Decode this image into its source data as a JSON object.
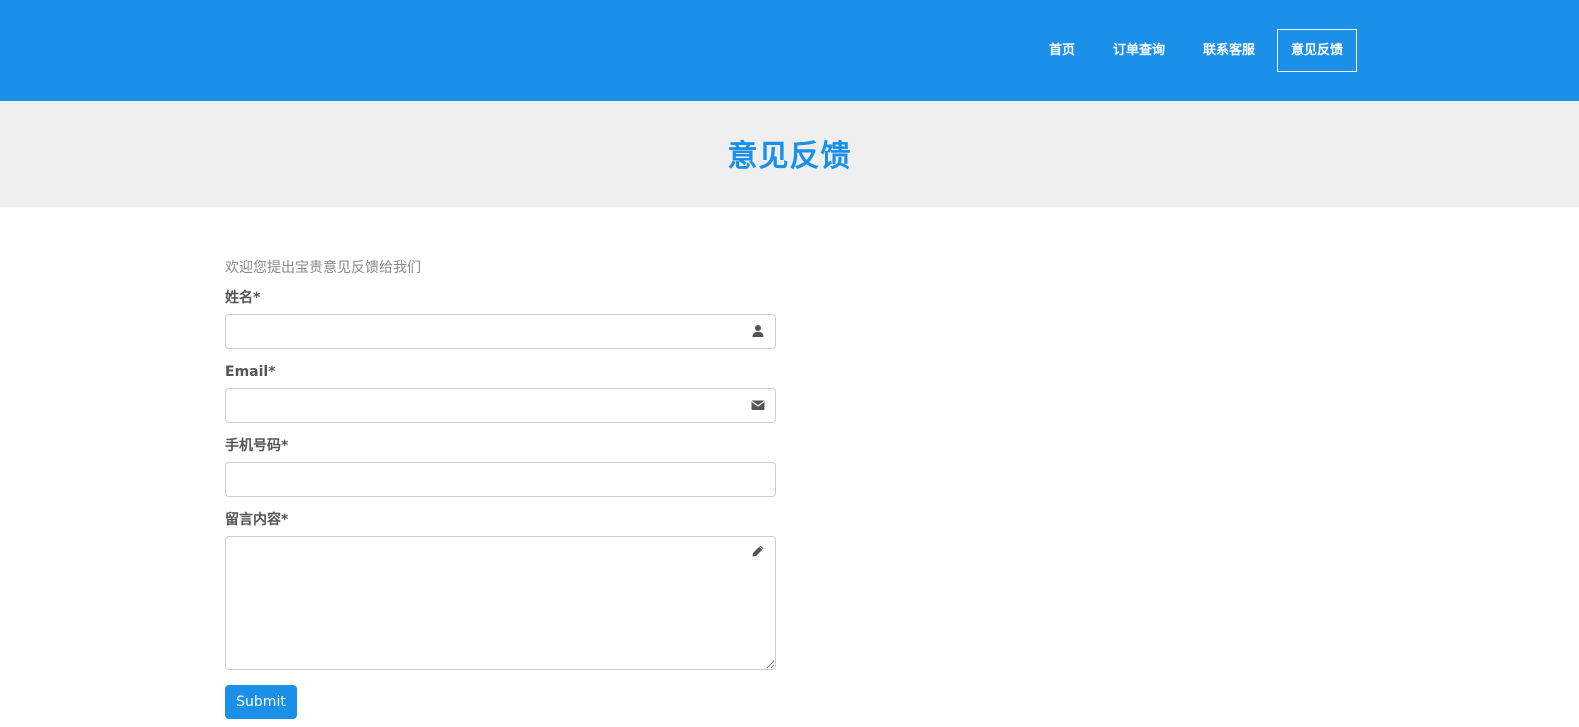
{
  "nav": {
    "items": [
      {
        "label": "首页",
        "active": false
      },
      {
        "label": "订单查询",
        "active": false
      },
      {
        "label": "联系客服",
        "active": false
      },
      {
        "label": "意见反馈",
        "active": true
      }
    ]
  },
  "banner": {
    "title": "意见反馈"
  },
  "form": {
    "intro": "欢迎您提出宝贵意见反馈给我们",
    "name_label": "姓名*",
    "name_value": "",
    "email_label": "Email*",
    "email_value": "",
    "phone_label": "手机号码*",
    "phone_value": "",
    "message_label": "留言内容*",
    "message_value": "",
    "submit_label": "Submit"
  },
  "icons": {
    "name": "user-icon",
    "email": "envelope-icon",
    "message": "pencil-icon"
  },
  "colors": {
    "primary": "#1a90e8",
    "banner_bg": "#efefef",
    "text": "#555555",
    "muted": "#888888",
    "border": "#cccccc"
  }
}
